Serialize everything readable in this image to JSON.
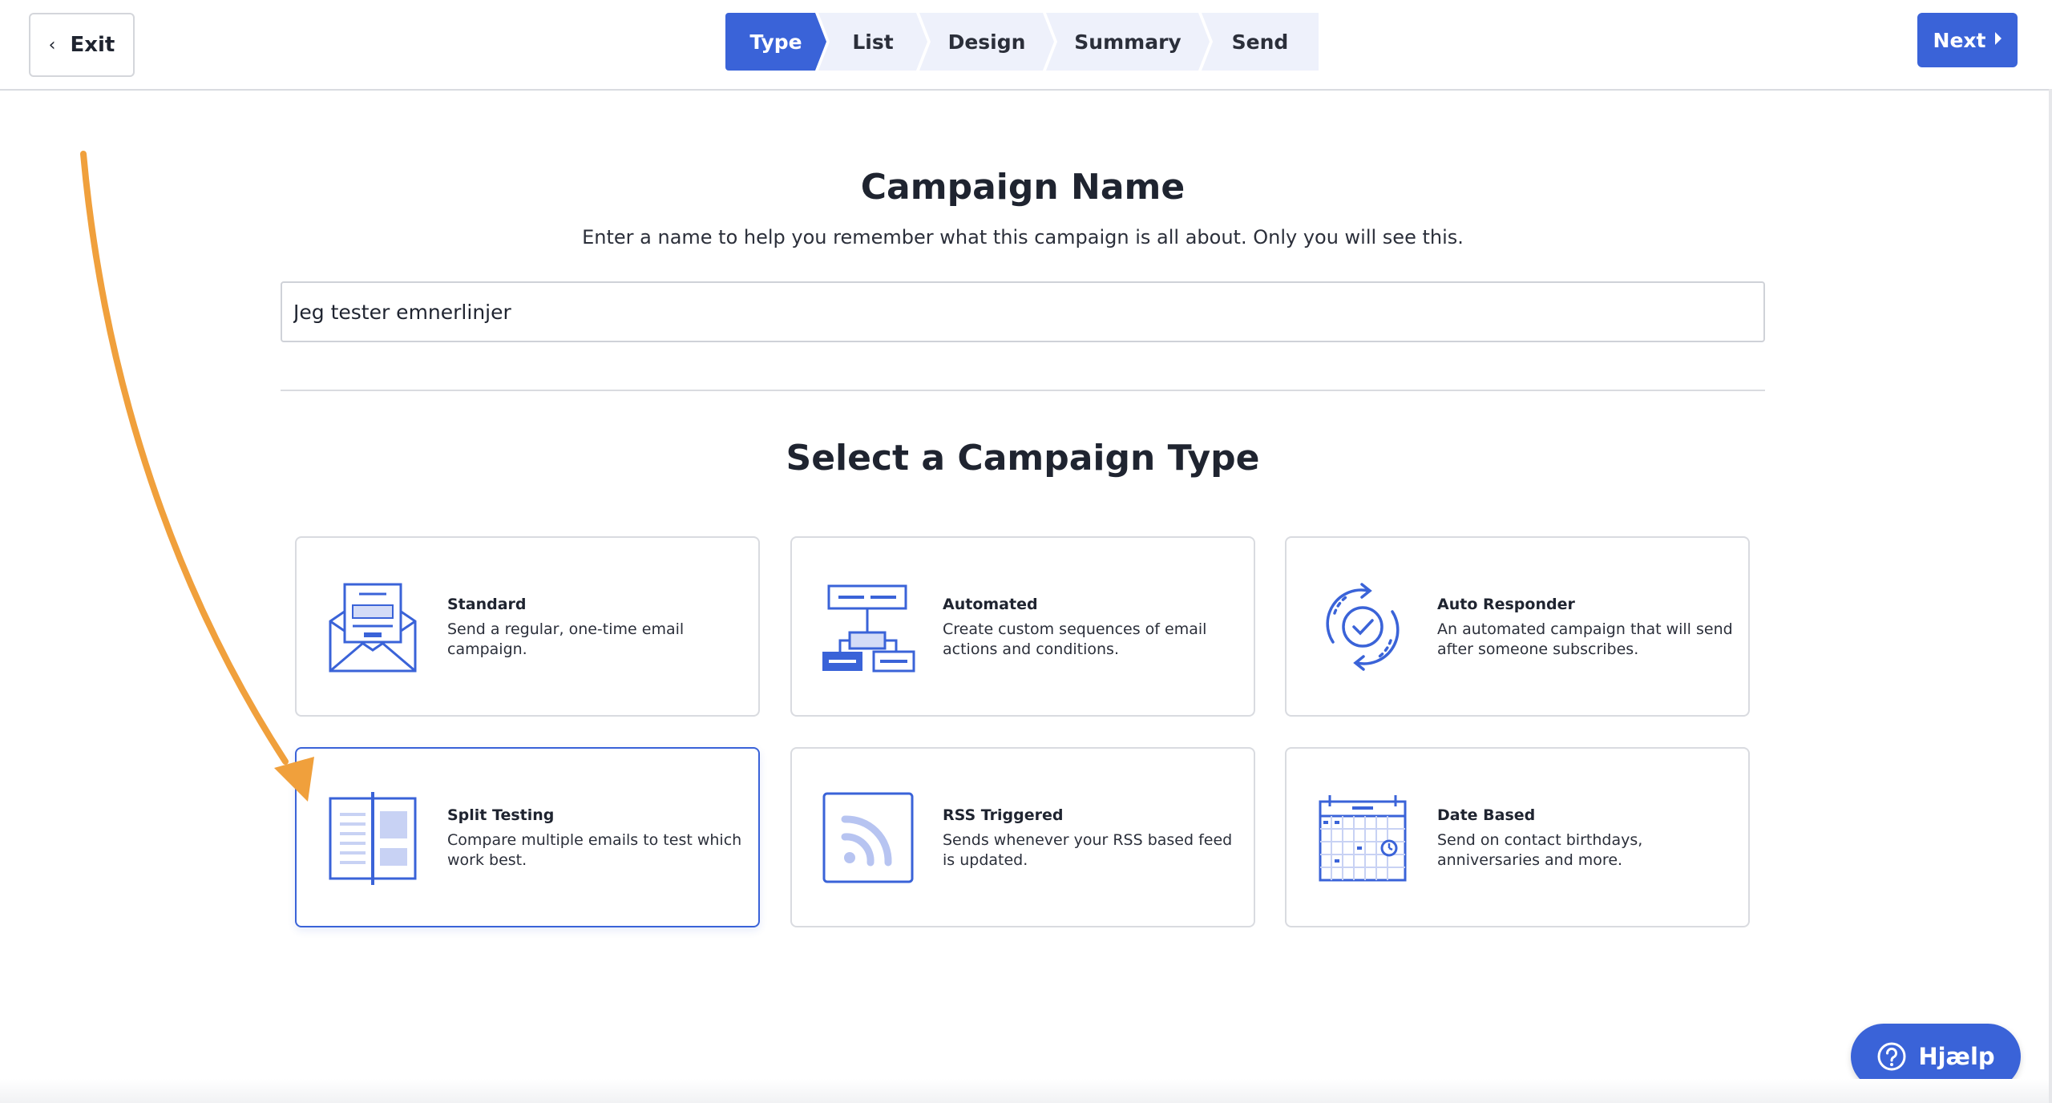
{
  "header": {
    "exit_label": "Exit",
    "steps": [
      "Type",
      "List",
      "Design",
      "Summary",
      "Send"
    ],
    "active_step": "Type",
    "next_label": "Next"
  },
  "campaign_name": {
    "title": "Campaign Name",
    "subtitle": "Enter a name to help you remember what this campaign is all about. Only you will see this.",
    "value": "Jeg tester emnerlinjer"
  },
  "campaign_type": {
    "title": "Select a Campaign Type",
    "cards": [
      {
        "title": "Standard",
        "desc": "Send a regular, one-time email campaign.",
        "icon": "envelope-icon"
      },
      {
        "title": "Automated",
        "desc": "Create custom sequences of email actions and conditions.",
        "icon": "flowchart-icon"
      },
      {
        "title": "Auto Responder",
        "desc": "An automated campaign that will send after someone subscribes.",
        "icon": "refresh-check-icon"
      },
      {
        "title": "Split Testing",
        "desc": "Compare multiple emails to test which work best.",
        "icon": "split-layout-icon",
        "selected": true
      },
      {
        "title": "RSS Triggered",
        "desc": "Sends whenever your RSS based feed is updated.",
        "icon": "rss-icon"
      },
      {
        "title": "Date Based",
        "desc": "Send on contact birthdays, anniversaries and more.",
        "icon": "calendar-icon"
      }
    ]
  },
  "help": {
    "label": "Hjælp",
    "icon": "question-circle-icon"
  },
  "colors": {
    "accent": "#3a63d8",
    "annotation_arrow": "#f0a03c",
    "step_inactive_bg": "#eef1fb"
  }
}
